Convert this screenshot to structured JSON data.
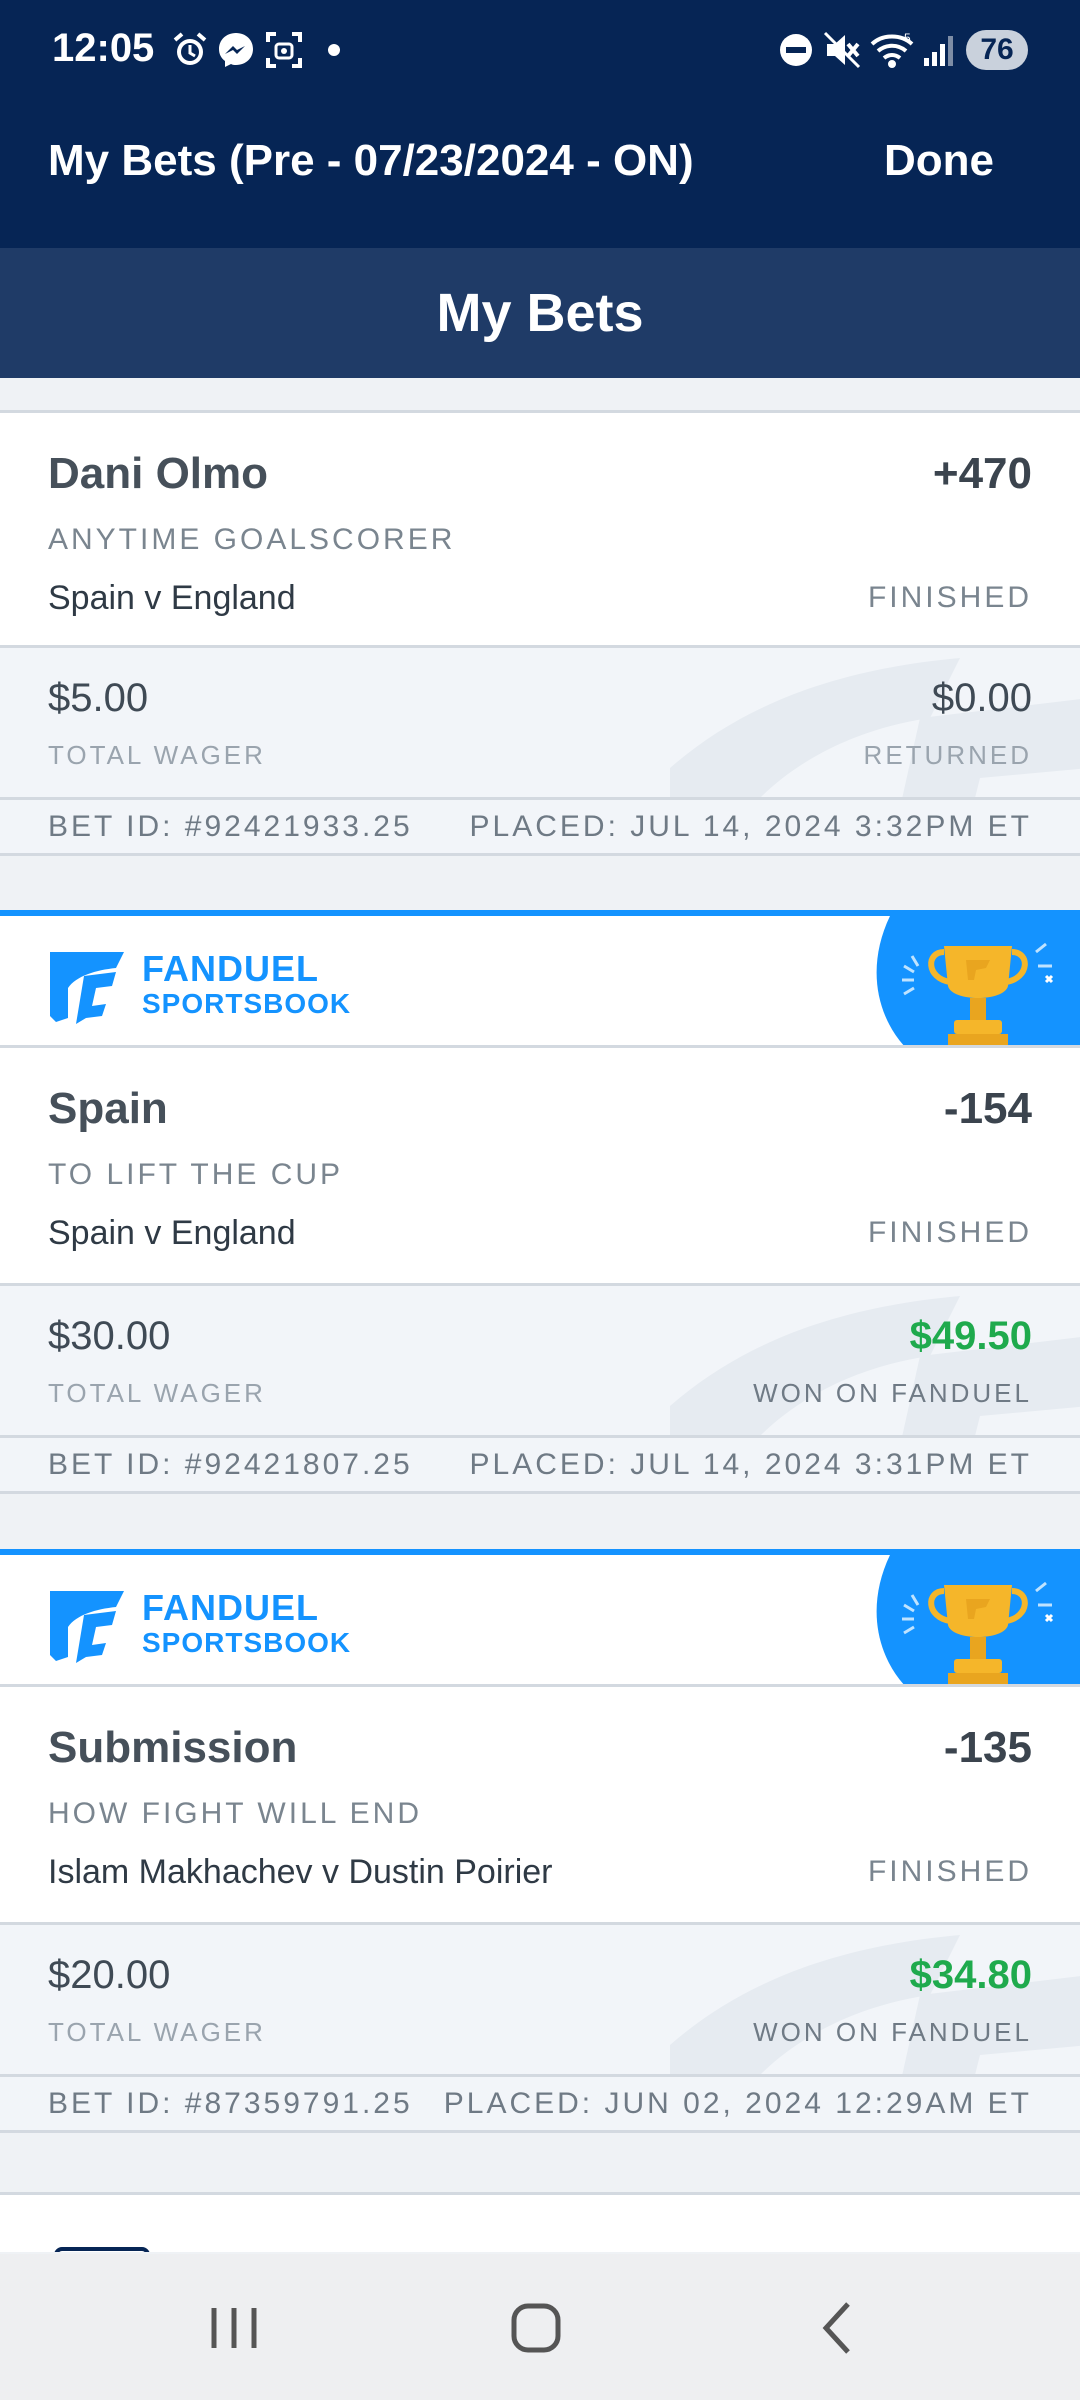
{
  "status_bar": {
    "time": "12:05",
    "battery": "76",
    "icons": [
      "alarm-icon",
      "messenger-icon",
      "screenshot-icon",
      "dot-icon",
      "dnd-icon",
      "mute-icon",
      "wifi-icon",
      "signal-icon"
    ]
  },
  "header": {
    "title": "My Bets (Pre - 07/23/2024 - ON)",
    "done_label": "Done"
  },
  "section": {
    "title": "My Bets"
  },
  "promo": {
    "brand_line1": "FANDUEL",
    "brand_line2": "SPORTSBOOK"
  },
  "bets": [
    {
      "selection": "Dani Olmo",
      "odds": "+470",
      "market": "ANYTIME GOALSCORER",
      "event": "Spain v England",
      "status": "FINISHED",
      "wager": "$5.00",
      "wager_label": "TOTAL WAGER",
      "return": "$0.00",
      "return_label": "RETURNED",
      "bet_id": "BET ID: #92421933.25",
      "placed": "PLACED: JUL 14, 2024 3:32PM ET"
    },
    {
      "selection": "Spain",
      "odds": "-154",
      "market": "TO LIFT THE CUP",
      "event": "Spain v England",
      "status": "FINISHED",
      "wager": "$30.00",
      "wager_label": "TOTAL WAGER",
      "return": "$49.50",
      "return_label": "WON ON FANDUEL",
      "bet_id": "BET ID: #92421807.25",
      "placed": "PLACED: JUL 14, 2024 3:31PM ET"
    },
    {
      "selection": "Submission",
      "odds": "-135",
      "market": "HOW FIGHT WILL END",
      "event": "Islam Makhachev v Dustin Poirier",
      "status": "FINISHED",
      "wager": "$20.00",
      "wager_label": "TOTAL WAGER",
      "return": "$34.80",
      "return_label": "WON ON FANDUEL",
      "bet_id": "BET ID: #87359791.25",
      "placed": "PLACED: JUN 02, 2024 12:29AM ET"
    }
  ],
  "colors": {
    "header_bg": "#062555",
    "section_bg": "#1f3b67",
    "brand_blue": "#1493ff",
    "won_green": "#1faa4d"
  }
}
